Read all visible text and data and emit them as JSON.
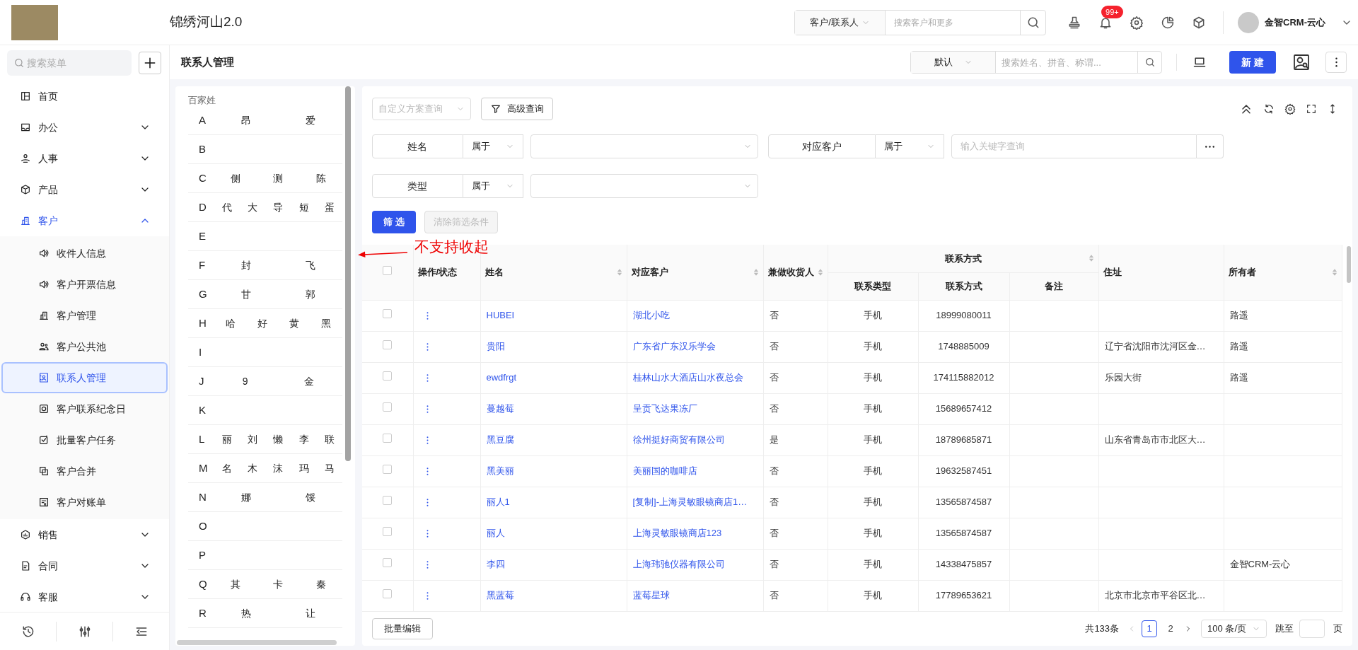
{
  "header": {
    "title": "锦绣河山2.0",
    "search_scope": "客户/联系人",
    "search_placeholder": "搜索客户和更多",
    "notification_badge": "99+",
    "user_name": "金智CRM-云心"
  },
  "sidebar": {
    "search_placeholder": "搜索菜单",
    "items": [
      {
        "label": "首页"
      },
      {
        "label": "办公",
        "expanded": false
      },
      {
        "label": "人事",
        "expanded": false
      },
      {
        "label": "产品",
        "expanded": false
      },
      {
        "label": "客户",
        "expanded": true,
        "children": [
          {
            "label": "收件人信息",
            "selected": false
          },
          {
            "label": "客户开票信息",
            "selected": false
          },
          {
            "label": "客户管理",
            "selected": false
          },
          {
            "label": "客户公共池",
            "selected": false
          },
          {
            "label": "联系人管理",
            "selected": true
          },
          {
            "label": "客户联系纪念日",
            "selected": false
          },
          {
            "label": "批量客户任务",
            "selected": false
          },
          {
            "label": "客户合并",
            "selected": false
          },
          {
            "label": "客户对账单",
            "selected": false
          }
        ]
      },
      {
        "label": "销售",
        "expanded": false
      },
      {
        "label": "合同",
        "expanded": false
      },
      {
        "label": "客服",
        "expanded": false
      }
    ]
  },
  "page": {
    "title": "联系人管理",
    "view_select": "默认",
    "search_placeholder": "搜索姓名、拼音、称谓...",
    "new_button": "新 建"
  },
  "surname_index": {
    "title": "百家姓",
    "groups": [
      {
        "letter": "A",
        "names": [
          "昂",
          "爱"
        ]
      },
      {
        "letter": "B"
      },
      {
        "letter": "C",
        "names": [
          "侧",
          "测",
          "陈"
        ]
      },
      {
        "letter": "D",
        "names": [
          "代",
          "大",
          "导",
          "短",
          "蛋"
        ]
      },
      {
        "letter": "E"
      },
      {
        "letter": "F",
        "names": [
          "封",
          "飞"
        ]
      },
      {
        "letter": "G",
        "names": [
          "甘",
          "郭"
        ]
      },
      {
        "letter": "H",
        "names": [
          "哈",
          "好",
          "黄",
          "黑"
        ]
      },
      {
        "letter": "I"
      },
      {
        "letter": "J",
        "names": [
          "9",
          "金"
        ]
      },
      {
        "letter": "K"
      },
      {
        "letter": "L",
        "names": [
          "丽",
          "刘",
          "懒",
          "李",
          "联"
        ]
      },
      {
        "letter": "M",
        "names": [
          "名",
          "木",
          "沫",
          "玛",
          "马"
        ]
      },
      {
        "letter": "N",
        "names": [
          "娜",
          "馁"
        ]
      },
      {
        "letter": "O"
      },
      {
        "letter": "P"
      },
      {
        "letter": "Q",
        "names": [
          "其",
          "卡",
          "秦"
        ]
      },
      {
        "letter": "R",
        "names": [
          "热",
          "让"
        ]
      }
    ]
  },
  "annotation": {
    "text": "不支持收起"
  },
  "filters": {
    "scheme_placeholder": "自定义方案查询",
    "advanced_button": "高级查询",
    "conditions": [
      {
        "kind": "select",
        "field": "姓名",
        "operator": "属于"
      },
      {
        "kind": "text",
        "field": "对应客户",
        "operator": "属于",
        "placeholder": "输入关键字查询"
      },
      {
        "kind": "select",
        "field": "类型",
        "operator": "属于"
      }
    ],
    "apply_button": "筛 选",
    "clear_button": {
      "label": "清除筛选条件",
      "disabled": true
    }
  },
  "table": {
    "select_all_checked": false,
    "columns_before": [
      {
        "label": "操作/状态",
        "sortable": false
      },
      {
        "label": "姓名",
        "sortable": true
      },
      {
        "label": "对应客户",
        "sortable": true
      },
      {
        "label": "兼做收货人",
        "sortable": true
      }
    ],
    "column_group": {
      "label": "联系方式",
      "sortable": true,
      "columns": [
        "联系类型",
        "联系方式",
        "备注"
      ]
    },
    "columns_after": [
      {
        "label": "住址",
        "sortable": false
      },
      {
        "label": "所有者",
        "sortable": true
      }
    ],
    "rows": [
      {
        "checked": false,
        "name": "HUBEI",
        "customer": "湖北小吃",
        "also_receiver": "否",
        "contact_type": "手机",
        "phone": "18999080011",
        "owner": "路遥"
      },
      {
        "checked": false,
        "name": "贵阳",
        "customer": "广东省广东汉乐学会",
        "also_receiver": "否",
        "contact_type": "手机",
        "phone": "1748885009",
        "address": "辽宁省沈阳市沈河区金…",
        "owner": "路遥"
      },
      {
        "checked": false,
        "name": "ewdfrgt",
        "customer": "桂林山水大酒店山水夜总会",
        "also_receiver": "否",
        "contact_type": "手机",
        "phone": "174115882012",
        "address": "乐园大街",
        "owner": "路遥"
      },
      {
        "checked": false,
        "name": "蔓越莓",
        "customer": "呈贡飞达果冻厂",
        "also_receiver": "否",
        "contact_type": "手机",
        "phone": "15689657412"
      },
      {
        "checked": false,
        "name": "黑豆腐",
        "customer": "徐州挺好商贸有限公司",
        "also_receiver": "是",
        "contact_type": "手机",
        "phone": "18789685871",
        "address": "山东省青岛市市北区大…"
      },
      {
        "checked": false,
        "name": "黑美丽",
        "customer": "美丽国的咖啡店",
        "also_receiver": "否",
        "contact_type": "手机",
        "phone": "19632587451"
      },
      {
        "checked": false,
        "name": "丽人1",
        "customer": "[复制]-上海灵敏眼镜商店1…",
        "also_receiver": "否",
        "contact_type": "手机",
        "phone": "13565874587"
      },
      {
        "checked": false,
        "name": "丽人",
        "customer": "上海灵敏眼镜商店123",
        "also_receiver": "否",
        "contact_type": "手机",
        "phone": "13565874587"
      },
      {
        "checked": false,
        "name": "李四",
        "customer": "上海玮驰仪器有限公司",
        "also_receiver": "否",
        "contact_type": "手机",
        "phone": "14338475857",
        "owner": "金智CRM-云心"
      },
      {
        "checked": false,
        "name": "黑蓝莓",
        "customer": "蓝莓星球",
        "also_receiver": "否",
        "contact_type": "手机",
        "phone": "17789653621",
        "address": "北京市北京市平谷区北…"
      }
    ]
  },
  "pagination": {
    "bulk_edit_button": "批量编辑",
    "total": "共133条",
    "pages": [
      {
        "label": "1",
        "selected": true
      },
      {
        "label": "2",
        "selected": false
      }
    ],
    "page_size": "100 条/页",
    "jump_label": "跳至",
    "page_unit": "页"
  }
}
